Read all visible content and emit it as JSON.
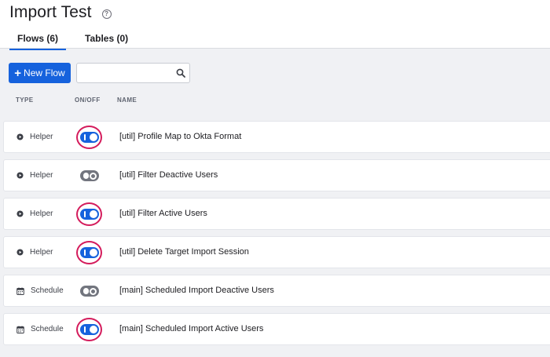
{
  "header": {
    "title": "Import Test",
    "help_icon": "?"
  },
  "tabs": [
    {
      "label": "Flows (6)",
      "active": true
    },
    {
      "label": "Tables (0)",
      "active": false
    }
  ],
  "toolbar": {
    "new_flow_label": "New Flow",
    "search_value": "",
    "search_placeholder": ""
  },
  "columns": {
    "type": "TYPE",
    "onoff": "ON/OFF",
    "name": "NAME"
  },
  "flows": [
    {
      "type": "Helper",
      "type_icon": "play-icon",
      "on": true,
      "name": "[util] Profile Map to Okta Format"
    },
    {
      "type": "Helper",
      "type_icon": "play-icon",
      "on": false,
      "name": "[util] Filter Deactive Users"
    },
    {
      "type": "Helper",
      "type_icon": "play-icon",
      "on": true,
      "name": "[util] Filter Active Users"
    },
    {
      "type": "Helper",
      "type_icon": "play-icon",
      "on": true,
      "name": "[util] Delete Target Import Session"
    },
    {
      "type": "Schedule",
      "type_icon": "calendar-icon",
      "on": false,
      "name": "[main] Scheduled Import Deactive Users"
    },
    {
      "type": "Schedule",
      "type_icon": "calendar-icon",
      "on": true,
      "name": "[main] Scheduled Import Active Users"
    }
  ],
  "colors": {
    "primary": "#1662dd",
    "highlight_ring": "#d41c5c",
    "toggle_off": "#72757e"
  }
}
